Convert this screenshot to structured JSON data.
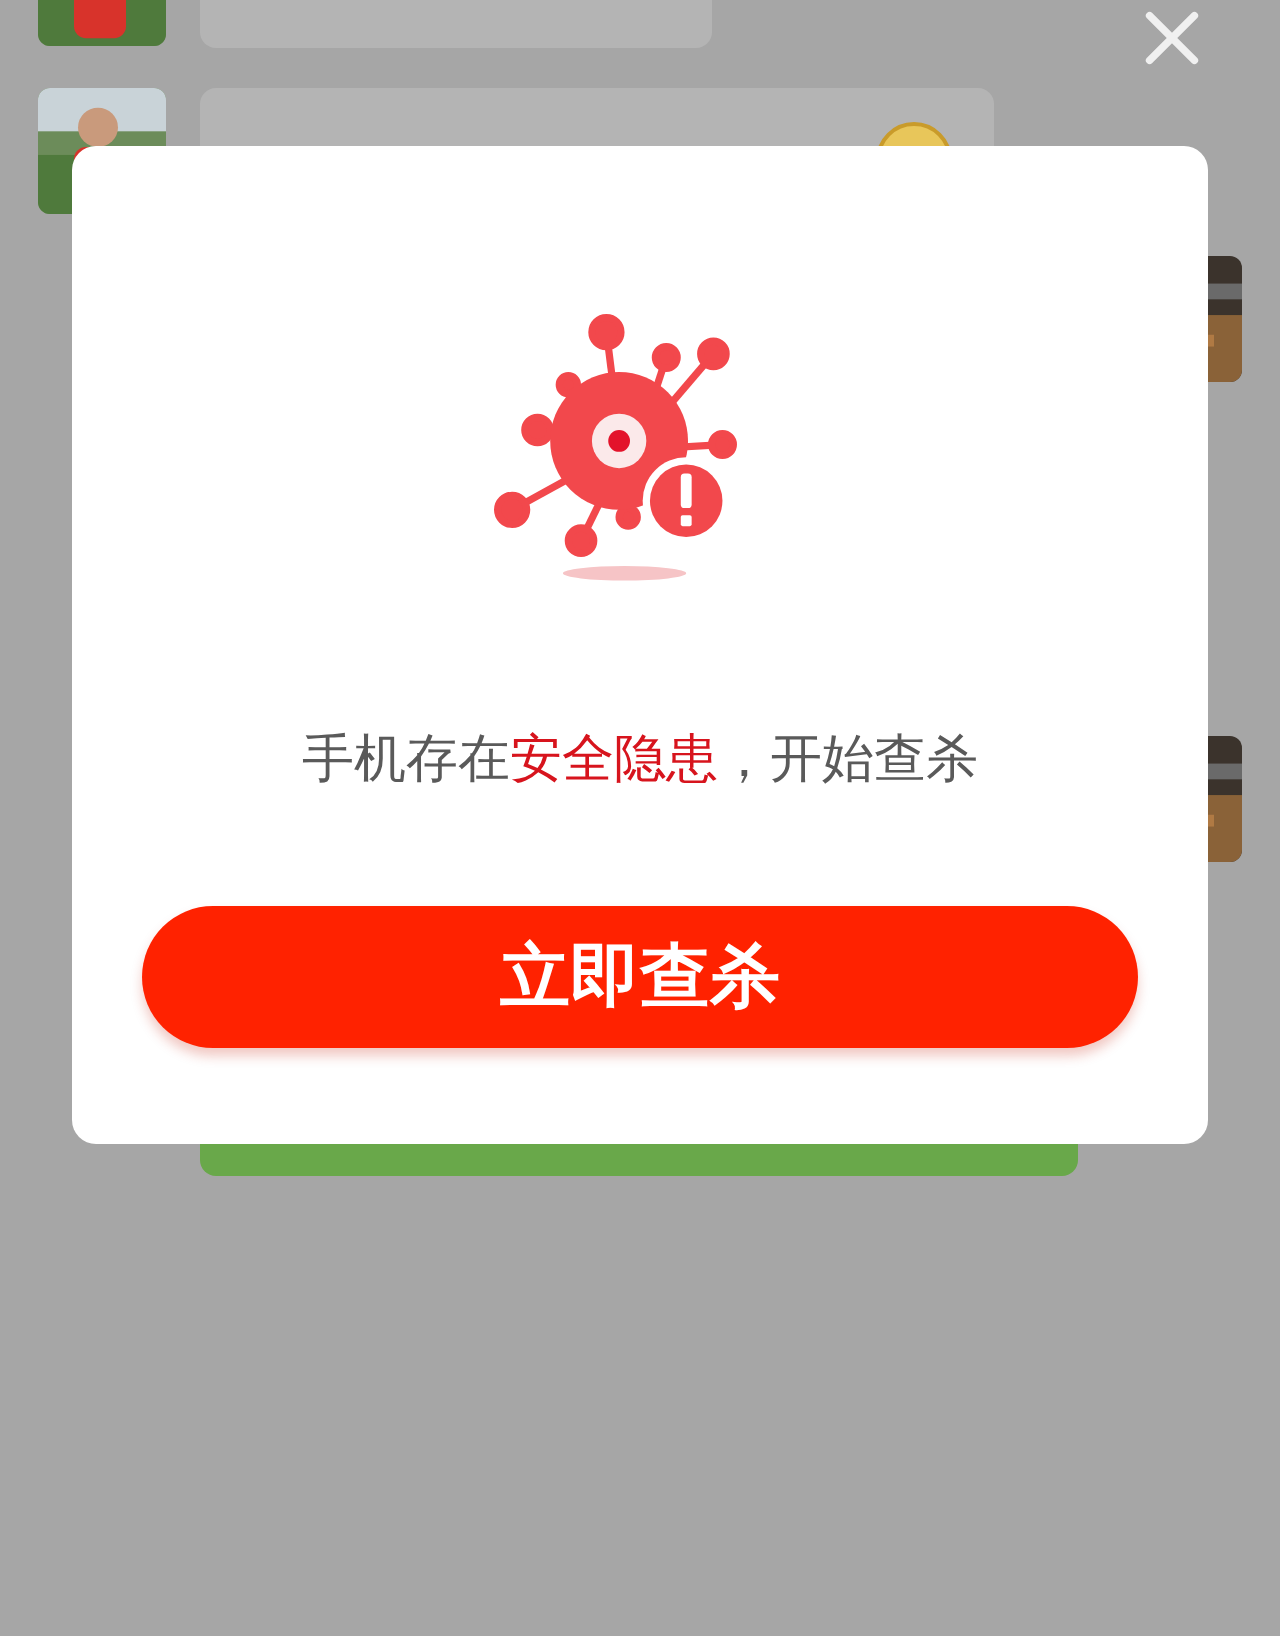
{
  "chat": {
    "messages": [
      {
        "kind": "left"
      },
      {
        "kind": "left-emoji"
      },
      {
        "kind": "right"
      },
      {
        "kind": "right"
      },
      {
        "kind": "green"
      }
    ]
  },
  "dialog": {
    "message": [
      {
        "text": "手机存在",
        "highlight": false
      },
      {
        "text": "安全隐患",
        "highlight": true
      },
      {
        "text": "，开始查杀",
        "highlight": false
      }
    ],
    "button": "立即查杀"
  }
}
